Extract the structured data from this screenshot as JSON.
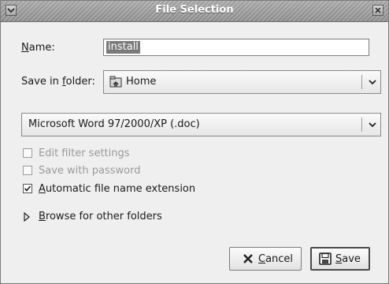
{
  "window": {
    "title": "File Selection"
  },
  "name_row": {
    "label_accel": "N",
    "label_rest": "ame:",
    "value": "install"
  },
  "folder_row": {
    "label_pre": "Save in ",
    "label_accel": "f",
    "label_post": "older:",
    "value": "Home",
    "icon": "home-folder-icon"
  },
  "filter": {
    "value": "Microsoft Word 97/2000/XP (.doc)"
  },
  "options": {
    "edit_filter_label": "Edit filter settings",
    "edit_filter_checked": false,
    "save_password_label": "Save with password",
    "save_password_checked": false,
    "auto_ext_accel": "A",
    "auto_ext_rest": "utomatic file name extension",
    "auto_ext_checked": true
  },
  "browse": {
    "accel": "B",
    "rest": "rowse for other folders"
  },
  "buttons": {
    "cancel_accel": "C",
    "cancel_rest": "ancel",
    "save_accel": "S",
    "save_rest": "ave"
  },
  "colors": {
    "titlebar": "#9a9a9a",
    "dialog_bg": "#efefef",
    "selection": "#7a7a7a"
  }
}
